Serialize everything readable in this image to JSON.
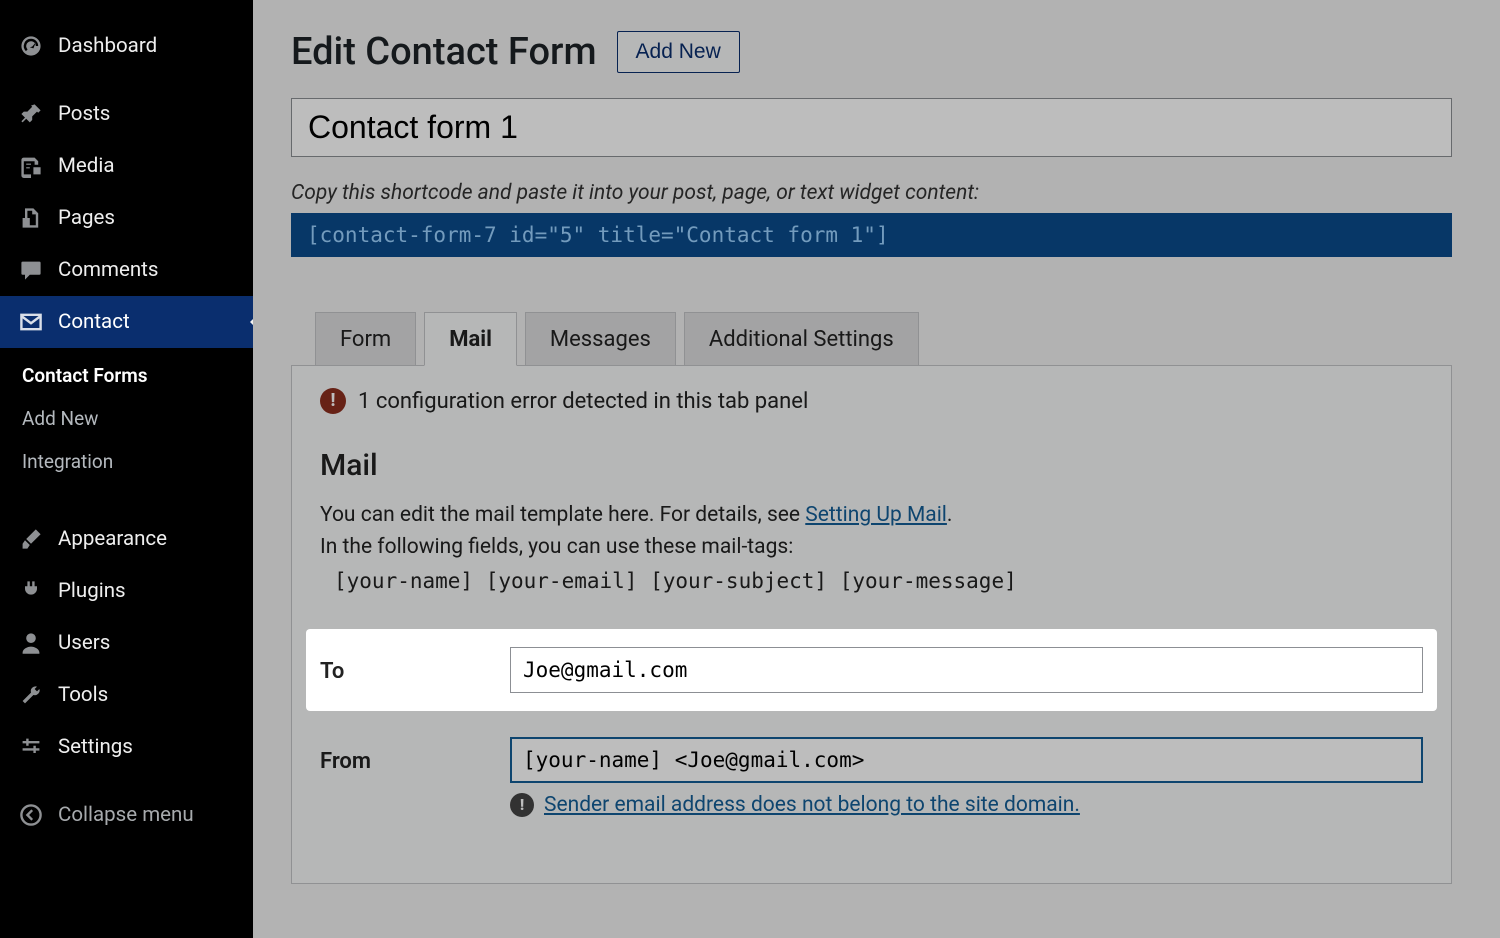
{
  "sidebar": {
    "items": [
      {
        "label": "Dashboard"
      },
      {
        "label": "Posts"
      },
      {
        "label": "Media"
      },
      {
        "label": "Pages"
      },
      {
        "label": "Comments"
      },
      {
        "label": "Contact"
      },
      {
        "label": "Appearance"
      },
      {
        "label": "Plugins"
      },
      {
        "label": "Users"
      },
      {
        "label": "Tools"
      },
      {
        "label": "Settings"
      },
      {
        "label": "Collapse menu"
      }
    ],
    "submenu": {
      "forms": "Contact Forms",
      "add": "Add New",
      "integration": "Integration"
    }
  },
  "header": {
    "title": "Edit Contact Form",
    "add_new": "Add New"
  },
  "form": {
    "title_value": "Contact form 1",
    "shortcode_hint": "Copy this shortcode and paste it into your post, page, or text widget content:",
    "shortcode": "[contact-form-7 id=\"5\" title=\"Contact form 1\"]"
  },
  "tabs": {
    "form": "Form",
    "mail": "Mail",
    "messages": "Messages",
    "additional": "Additional Settings"
  },
  "panel": {
    "error_text": "1 configuration error detected in this tab panel",
    "heading": "Mail",
    "help_prefix": "You can edit the mail template here. For details, see ",
    "help_link": "Setting Up Mail",
    "help_suffix": ".",
    "help_line2": "In the following fields, you can use these mail-tags:",
    "tags": "[your-name] [your-email] [your-subject] [your-message]",
    "to_label": "To",
    "to_value": "Joe@gmail.com",
    "from_label": "From",
    "from_value": "[your-name] <Joe@gmail.com>",
    "from_warning": "Sender email address does not belong to the site domain."
  }
}
